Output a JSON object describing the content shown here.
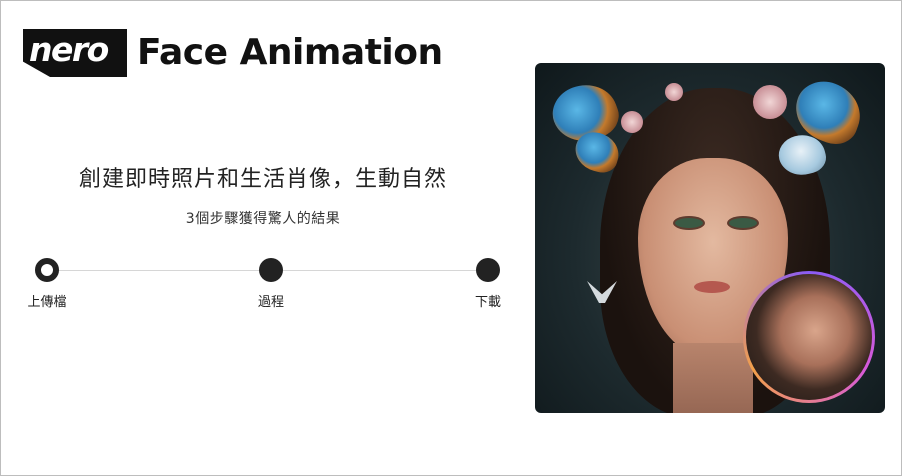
{
  "brand": {
    "logo_text": "nero",
    "product_name": "Face Animation"
  },
  "hero": {
    "headline": "創建即時照片和生活肖像，生動自然",
    "subheadline": "3個步驟獲得驚人的結果"
  },
  "stepper": {
    "steps": [
      {
        "label": "上傳檔",
        "state": "active"
      },
      {
        "label": "過程",
        "state": "pending"
      },
      {
        "label": "下載",
        "state": "pending"
      }
    ]
  },
  "colors": {
    "text": "#222222",
    "line": "#d6d6d6",
    "inset_ring": [
      "#8a5cf6",
      "#d75ad9",
      "#f2a04a"
    ]
  },
  "images": {
    "main": "fantasy-portrait-woman-butterflies",
    "inset": "realistic-portrait-woman"
  }
}
